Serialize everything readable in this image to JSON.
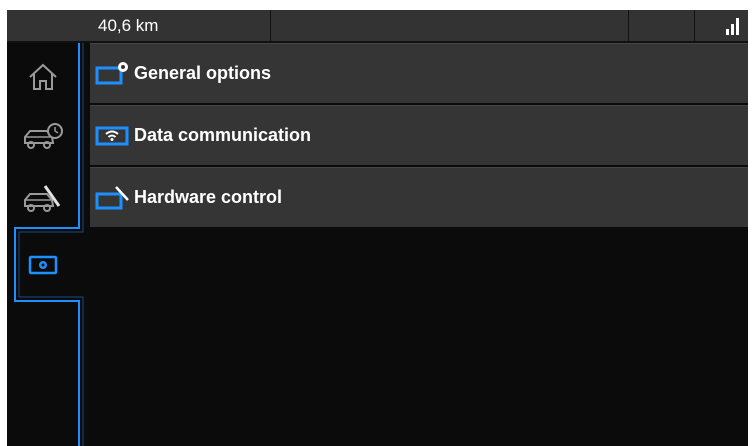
{
  "statusbar": {
    "distance": "40,6 km",
    "signal_icon": "signal-bars-icon"
  },
  "sidebar": {
    "items": [
      {
        "icon": "home-icon",
        "selected": false
      },
      {
        "icon": "car-clock-icon",
        "selected": false
      },
      {
        "icon": "car-wrench-icon",
        "selected": false
      },
      {
        "icon": "settings-box-icon",
        "selected": true
      }
    ]
  },
  "menu": {
    "items": [
      {
        "label": "General options",
        "icon": "settings-gear-icon"
      },
      {
        "label": "Data communication",
        "icon": "wifi-icon"
      },
      {
        "label": "Hardware control",
        "icon": "wrench-icon"
      }
    ]
  },
  "colors": {
    "accent": "#1e8fff",
    "background": "#0b0b0b",
    "panel": "#353535",
    "statusbar": "#333333"
  }
}
